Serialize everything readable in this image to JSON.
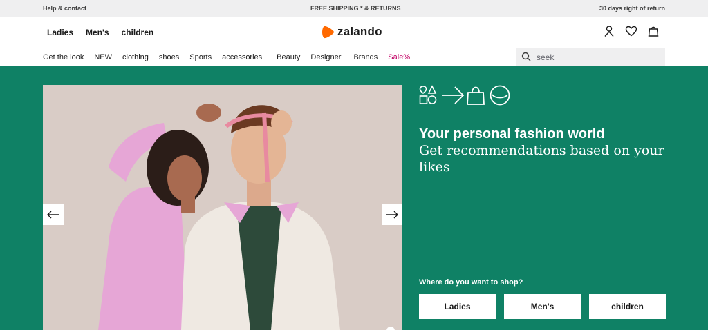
{
  "topbar": {
    "help": "Help & contact",
    "shipping": "FREE SHIPPING * & RETURNS",
    "returns": "30 days right of return"
  },
  "header": {
    "gender_nav": [
      "Ladies",
      "Men's",
      "children"
    ],
    "logo_text": "zalando",
    "icons": [
      "user-icon",
      "heart-icon",
      "bag-icon"
    ]
  },
  "category_nav": [
    "Get the look",
    "NEW",
    "clothing",
    "shoes",
    "Sports",
    "accessories",
    "Beauty",
    "Designer",
    "Brands",
    "Sale%"
  ],
  "search": {
    "placeholder": "seek"
  },
  "hero": {
    "title": "Your personal fashion world",
    "subtitle": "Get recommendations based on your likes",
    "shop_question": "Where do you want to shop?",
    "shop_buttons": [
      "Ladies",
      "Men's",
      "children"
    ],
    "feature_icons": [
      "shapes-icon",
      "arrow-right-icon",
      "shopping-bag-icon",
      "smile-icon"
    ],
    "background_color": "#0f8165"
  },
  "colors": {
    "accent": "#ff6900",
    "sale": "#c20064",
    "hero_bg": "#0f8165"
  }
}
